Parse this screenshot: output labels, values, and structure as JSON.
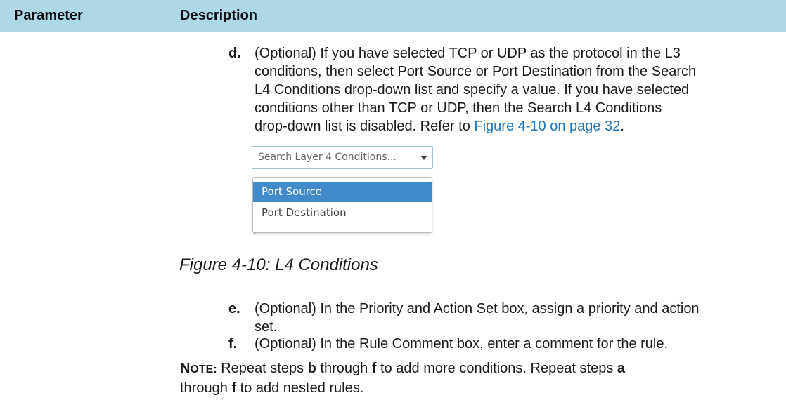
{
  "header": {
    "parameter": "Parameter",
    "description": "Description"
  },
  "step_d": {
    "letter": "d.",
    "lines": [
      "(Optional) If you have selected TCP or UDP as the protocol in the L3",
      "conditions, then select Port Source or Port Destination from the Search",
      "L4 Conditions drop-down list and specify a value. If you have selected",
      "conditions other than TCP or UDP, then the Search L4 Conditions"
    ],
    "last_prefix": "drop-down list is disabled. Refer to ",
    "link": "Figure 4-10 on page 32",
    "last_suffix": "."
  },
  "dropdown": {
    "placeholder": "Search Layer 4 Conditions...",
    "options": [
      "Port Source",
      "Port Destination"
    ],
    "selected": "Port Source",
    "highlight_color": "#428bca"
  },
  "caption": "Figure 4-10: L4 Conditions",
  "step_e": {
    "letter": "e.",
    "lines": [
      "(Optional) In the Priority and Action Set box, assign a priority and action",
      "set."
    ]
  },
  "step_f": {
    "letter": "f.",
    "text": "(Optional) In the Rule Comment box, enter a comment for the rule."
  },
  "note": {
    "label_initial": "N",
    "label_rest": "OTE:",
    "t1": " Repeat steps ",
    "b": "b",
    "t2": " through ",
    "f": "f",
    "t3": " to add more conditions. Repeat steps ",
    "a": "a",
    "t4": "through ",
    "f2": "f",
    "t5": " to add nested rules."
  },
  "link_color": "#1a78c2",
  "header_color": "#add8e6"
}
